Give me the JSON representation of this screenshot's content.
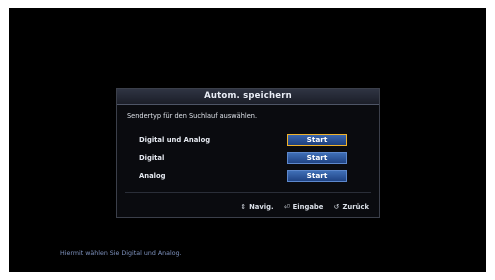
{
  "dialog": {
    "title": "Autom. speichern",
    "prompt": "Sendertyp für den Suchlauf auswählen.",
    "options": [
      {
        "label": "Digital und Analog",
        "button": "Start",
        "selected": true
      },
      {
        "label": "Digital",
        "button": "Start",
        "selected": false
      },
      {
        "label": "Analog",
        "button": "Start",
        "selected": false
      }
    ],
    "hints": [
      {
        "icon": "updown-arrows-icon",
        "glyph": "⇕",
        "label": "Navig."
      },
      {
        "icon": "enter-icon",
        "glyph": "⏎",
        "label": "Eingabe"
      },
      {
        "icon": "return-icon",
        "glyph": "↺",
        "label": "Zurück"
      }
    ]
  },
  "footer": {
    "text": "Hiermit wählen Sie Digital und Analog."
  },
  "colors": {
    "highlight": "#f0b22b",
    "button": "#2f5aa0"
  }
}
